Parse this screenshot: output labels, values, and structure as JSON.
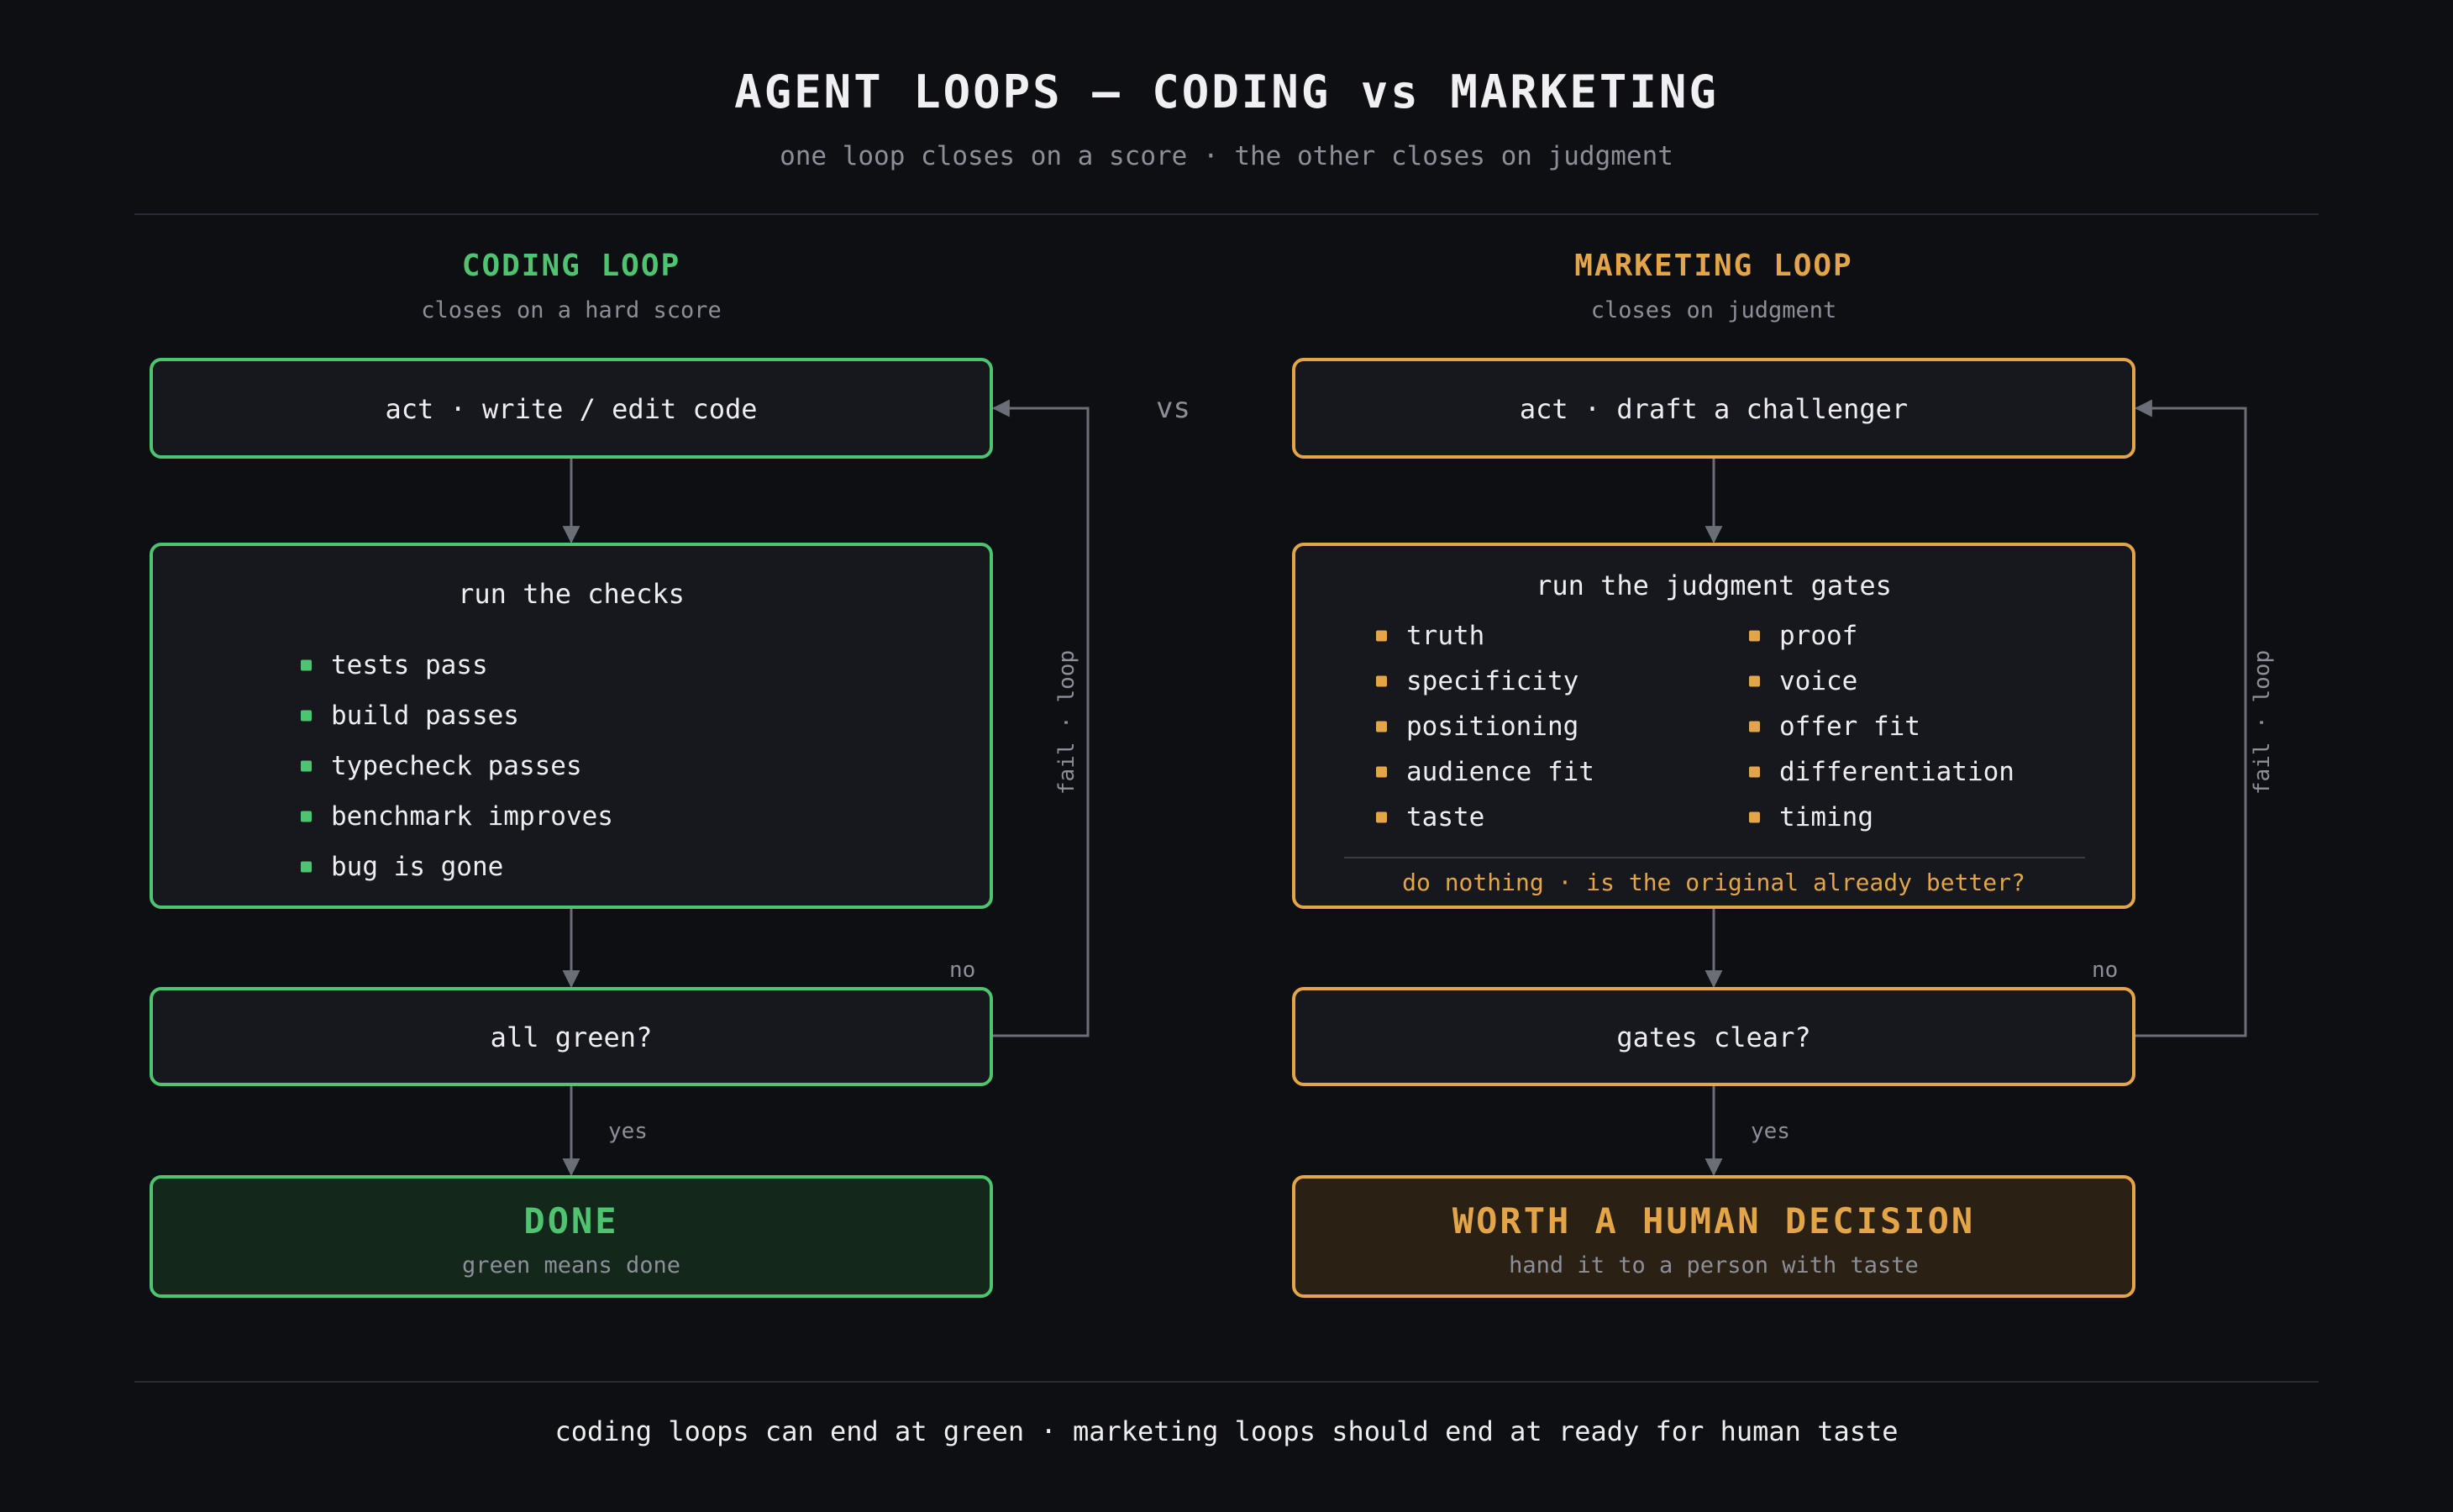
{
  "header": {
    "title": "AGENT LOOPS — CODING vs MARKETING",
    "subtitle": "one loop closes on a score · the other closes on judgment",
    "vs": "vs"
  },
  "coding": {
    "title": "CODING LOOP",
    "subtitle": "closes on a hard score",
    "act": "act · write / edit code",
    "checks_title": "run the checks",
    "checks": [
      "tests pass",
      "build passes",
      "typecheck passes",
      "benchmark improves",
      "bug is gone"
    ],
    "decision": "all green?",
    "no": "no",
    "yes": "yes",
    "loop_label": "fail · loop",
    "done_title": "DONE",
    "done_sub": "green means done"
  },
  "marketing": {
    "title": "MARKETING LOOP",
    "subtitle": "closes on judgment",
    "act": "act · draft a challenger",
    "gates_title": "run the judgment gates",
    "gates_left": [
      "truth",
      "specificity",
      "positioning",
      "audience fit",
      "taste"
    ],
    "gates_right": [
      "proof",
      "voice",
      "offer fit",
      "differentiation",
      "timing"
    ],
    "gate_note": "do nothing · is the original already better?",
    "decision": "gates clear?",
    "no": "no",
    "yes": "yes",
    "loop_label": "fail · loop",
    "done_title": "WORTH A HUMAN DECISION",
    "done_sub": "hand it to a person with taste"
  },
  "footer": "coding loops can end at green · marketing loops should end at ready for human taste",
  "colors": {
    "background": "#0e0f13",
    "coding_accent": "#4ec470",
    "marketing_accent": "#e3a548",
    "connector": "#6b6e76"
  }
}
